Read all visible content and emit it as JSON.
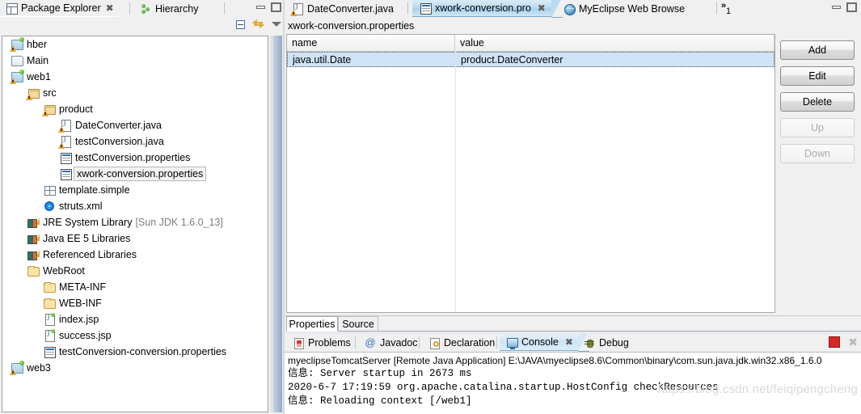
{
  "left_panel": {
    "tabs": [
      {
        "label": "Package Explorer",
        "icon": "package-explorer-icon",
        "active": true,
        "closable": true
      },
      {
        "label": "Hierarchy",
        "icon": "hierarchy-icon",
        "active": false,
        "closable": false
      }
    ],
    "window_controls": [
      "minimize",
      "maximize"
    ],
    "toolbar": [
      {
        "name": "collapse-all-icon"
      },
      {
        "name": "link-with-editor-icon"
      },
      {
        "name": "view-menu-icon"
      }
    ],
    "tree": [
      {
        "label": "hber",
        "icon": "java-project-icon",
        "indent": 0,
        "warning": true,
        "selected": false
      },
      {
        "label": "Main",
        "icon": "closed-project-icon",
        "indent": 0,
        "warning": false,
        "selected": false
      },
      {
        "label": "web1",
        "icon": "java-project-icon",
        "indent": 0,
        "warning": true,
        "selected": false
      },
      {
        "label": "src",
        "icon": "source-folder-icon",
        "indent": 1,
        "warning": true,
        "selected": false
      },
      {
        "label": "product",
        "icon": "package-icon",
        "indent": 2,
        "warning": true,
        "selected": false
      },
      {
        "label": "DateConverter.java",
        "icon": "java-file-icon",
        "indent": 3,
        "warning": true,
        "selected": false
      },
      {
        "label": "testConversion.java",
        "icon": "java-file-icon",
        "indent": 3,
        "warning": true,
        "selected": false
      },
      {
        "label": "testConversion.properties",
        "icon": "properties-file-icon",
        "indent": 3,
        "warning": false,
        "selected": false
      },
      {
        "label": "xwork-conversion.properties",
        "icon": "properties-file-icon",
        "indent": 3,
        "warning": false,
        "selected": true
      },
      {
        "label": "template.simple",
        "icon": "template-folder-icon",
        "indent": 2,
        "warning": false,
        "selected": false
      },
      {
        "label": "struts.xml",
        "icon": "struts-config-icon",
        "indent": 2,
        "warning": false,
        "selected": false
      },
      {
        "label": "JRE System Library",
        "suffix": "[Sun JDK 1.6.0_13]",
        "icon": "library-icon",
        "indent": 1,
        "warning": false,
        "selected": false
      },
      {
        "label": "Java EE 5 Libraries",
        "icon": "library-icon",
        "indent": 1,
        "warning": false,
        "selected": false
      },
      {
        "label": "Referenced Libraries",
        "icon": "library-icon",
        "indent": 1,
        "warning": false,
        "selected": false
      },
      {
        "label": "WebRoot",
        "icon": "folder-icon",
        "indent": 1,
        "warning": false,
        "selected": false
      },
      {
        "label": "META-INF",
        "icon": "folder-icon",
        "indent": 2,
        "warning": false,
        "selected": false
      },
      {
        "label": "WEB-INF",
        "icon": "folder-icon",
        "indent": 2,
        "warning": false,
        "selected": false
      },
      {
        "label": "index.jsp",
        "icon": "jsp-file-icon",
        "indent": 2,
        "warning": false,
        "selected": false
      },
      {
        "label": "success.jsp",
        "icon": "jsp-file-icon",
        "indent": 2,
        "warning": false,
        "selected": false
      },
      {
        "label": "testConversion-conversion.properties",
        "icon": "properties-file-icon",
        "indent": 2,
        "warning": false,
        "selected": false
      },
      {
        "label": "web3",
        "icon": "java-project-icon",
        "indent": 0,
        "warning": true,
        "selected": false
      }
    ]
  },
  "editor": {
    "tabs": [
      {
        "label": "DateConverter.java",
        "icon": "java-file-icon",
        "active": false,
        "closable": false
      },
      {
        "label": "xwork-conversion.pro",
        "icon": "properties-file-icon",
        "active": true,
        "closable": true
      },
      {
        "label": "MyEclipse Web Browse",
        "icon": "web-browser-icon",
        "active": false,
        "closable": false
      }
    ],
    "overflow_indicator": "1",
    "window_controls": [
      "minimize",
      "maximize"
    ],
    "file_title": "xwork-conversion.properties",
    "table": {
      "columns": [
        "name",
        "value"
      ],
      "rows": [
        {
          "name": "java.util.Date",
          "value": "product.DateConverter",
          "selected": true
        }
      ],
      "empty_row_count": 16
    },
    "buttons": [
      {
        "label": "Add",
        "enabled": true
      },
      {
        "label": "Edit",
        "enabled": true
      },
      {
        "label": "Delete",
        "enabled": true
      },
      {
        "label": "Up",
        "enabled": false
      },
      {
        "label": "Down",
        "enabled": false
      }
    ],
    "page_tabs": [
      {
        "label": "Properties",
        "active": true
      },
      {
        "label": "Source",
        "active": false
      }
    ]
  },
  "bottom_panel": {
    "tabs": [
      {
        "label": "Problems",
        "icon": "problems-icon",
        "active": false,
        "closable": false
      },
      {
        "label": "Javadoc",
        "icon": "javadoc-icon",
        "active": false,
        "closable": false
      },
      {
        "label": "Declaration",
        "icon": "declaration-icon",
        "active": false,
        "closable": false
      },
      {
        "label": "Console",
        "icon": "console-icon",
        "active": true,
        "closable": true
      },
      {
        "label": "Debug",
        "icon": "debug-icon",
        "active": false,
        "closable": false
      }
    ],
    "toolbar": [
      {
        "name": "terminate-button",
        "enabled": true
      },
      {
        "name": "remove-all-terminated-icon",
        "enabled": false
      }
    ],
    "console_lines": [
      {
        "text": "myeclipseTomcatServer [Remote Java Application] E:\\JAVA\\myeclipse8.6\\Common\\binary\\com.sun.java.jdk.win32.x86_1.6.0",
        "type": "header"
      },
      {
        "text": "信息: Server startup in 2673 ms",
        "type": "output"
      },
      {
        "text": "2020-6-7 17:19:59 org.apache.catalina.startup.HostConfig checkResources",
        "type": "output"
      },
      {
        "text": "信息: Reloading context [/web1]",
        "type": "output"
      }
    ],
    "watermark": "https://blog.csdn.net/feiqipengcheng"
  },
  "colors": {
    "accent": "#a8d2ea",
    "selection": "#cfe3f7",
    "panel_bg": "#f0f0f0",
    "stop_red": "#d62828"
  }
}
